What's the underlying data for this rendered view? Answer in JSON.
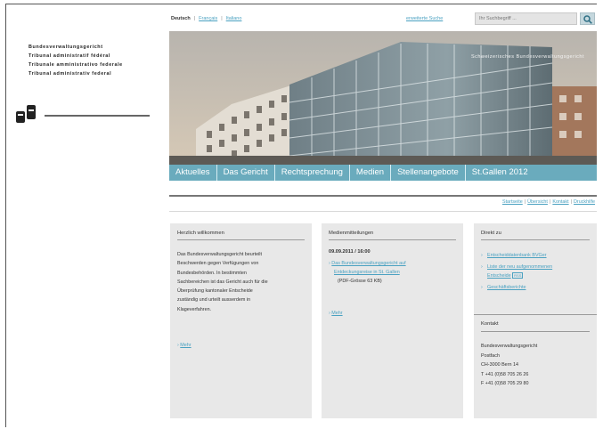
{
  "court_names": [
    "Bundesverwaltungsgericht",
    "Tribunal administratif fédéral",
    "Tribunale amministrativo federale",
    "Tribunal administrativ federal"
  ],
  "languages": {
    "active": "Deutsch",
    "links": [
      "Français",
      "Italiano"
    ]
  },
  "search": {
    "advanced_label": "erweiterte Suche",
    "placeholder": "Ihr Suchbegriff ..."
  },
  "hero": {
    "caption": "Schweizerisches Bundesverwaltungsgericht"
  },
  "nav": {
    "items": [
      "Aktuelles",
      "Das Gericht",
      "Rechtsprechung",
      "Medien",
      "Stellenangebote",
      "St.Gallen 2012"
    ]
  },
  "utility_nav": {
    "items": [
      "Startseite",
      "Übersicht",
      "Kontakt",
      "Druckhilfe"
    ]
  },
  "welcome": {
    "title": "Herzlich willkommen",
    "lines": [
      "Das Bundesverwaltungsgericht beurteilt",
      "Beschwerden gegen Verfügungen von",
      "Bundesbehörden. In bestimmten",
      "Sachbereichen ist das Gericht auch für die",
      "Überprüfung kantonaler Entscheide",
      "zuständig und urteilt ausserdem in",
      "Klageverfahren."
    ],
    "more_label": "Mehr"
  },
  "media": {
    "title": "Medienmitteilungen",
    "date": "09.09.2011 / 16:00",
    "item_lines": [
      "Das Bundesverwaltungsgericht auf",
      "Entdeckungsreise in St. Gallen"
    ],
    "pdf_note": "(PDF-Grösse 63 KB)",
    "more_label": "Mehr"
  },
  "direct": {
    "title": "Direkt zu",
    "links": [
      {
        "lines": [
          "Entscheiddatenbank BVGer"
        ]
      },
      {
        "lines": [
          "Liste der neu aufgenommenen",
          "Entscheide"
        ],
        "rss": "RSS"
      },
      {
        "lines": [
          "Geschäftsberichte"
        ]
      }
    ]
  },
  "contact": {
    "title": "Kontakt",
    "lines": [
      "Bundesverwaltungsgericht",
      "Postfach",
      "CH-3000 Bern 14",
      "T +41 (0)58 705 26 26",
      "F +41 (0)58 705 29 80"
    ]
  },
  "colors": {
    "nav_bg": "#6aabbd",
    "link": "#4aa1c1",
    "panel_bg": "#e8e8e8"
  }
}
